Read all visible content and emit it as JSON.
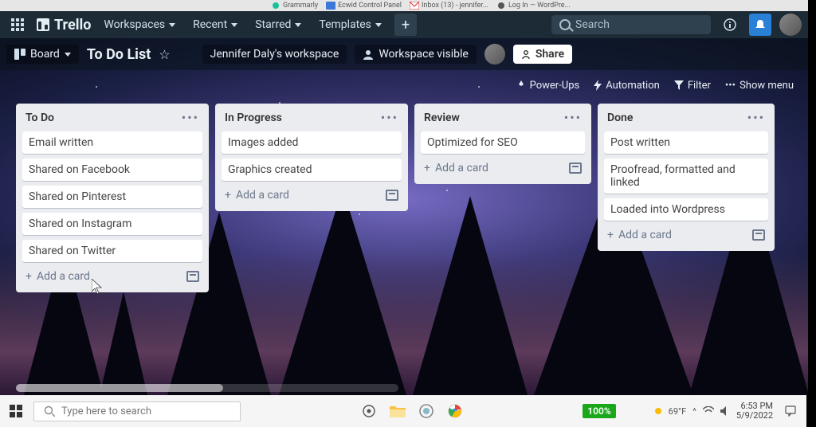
{
  "browser_tabs": [
    {
      "icon": "grammarly",
      "label": "Grammarly"
    },
    {
      "icon": "mail",
      "label": "Ecwid Control Panel"
    },
    {
      "icon": "gmail",
      "label": "Inbox (13) - jennifer..."
    },
    {
      "icon": "wp",
      "label": "Log In — WordPre..."
    }
  ],
  "topnav": {
    "logo": "Trello",
    "items": [
      "Workspaces",
      "Recent",
      "Starred",
      "Templates"
    ],
    "create_plus": "+",
    "search_placeholder": "Search"
  },
  "boardbar": {
    "view_label": "Board",
    "title": "To Do List",
    "workspace": "Jennifer Daly's workspace",
    "visibility": "Workspace visible",
    "share_label": "Share"
  },
  "secbar": {
    "powerups": "Power-Ups",
    "automation": "Automation",
    "filter": "Filter",
    "showmenu": "Show menu"
  },
  "lists": [
    {
      "title": "To Do",
      "cards": [
        "Email written",
        "Shared on Facebook",
        "Shared on Pinterest",
        "Shared on Instagram",
        "Shared on Twitter"
      ],
      "add": "Add a card"
    },
    {
      "title": "In Progress",
      "cards": [
        "Images added",
        "Graphics created"
      ],
      "add": "Add a card"
    },
    {
      "title": "Review",
      "cards": [
        "Optimized for SEO"
      ],
      "add": "Add a card"
    },
    {
      "title": "Done",
      "cards": [
        "Post written",
        "Proofread, formatted and linked",
        "Loaded into Wordpress"
      ],
      "add": "Add a card"
    }
  ],
  "taskbar": {
    "search_placeholder": "Type here to search",
    "battery": "100%",
    "weather": "69°F",
    "time": "6:53 PM",
    "date": "5/9/2022"
  }
}
